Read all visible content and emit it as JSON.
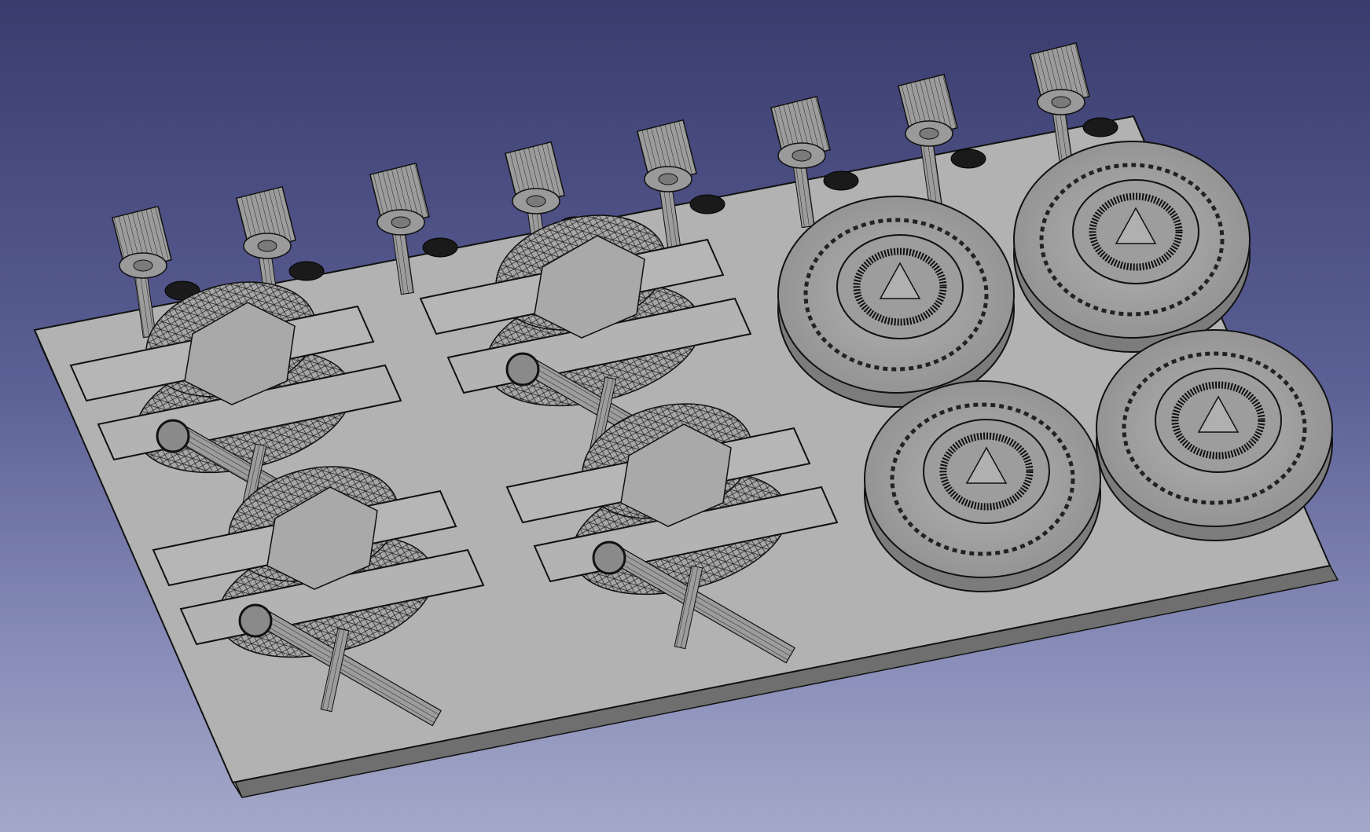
{
  "viewport": {
    "background_top": "#3a3c6e",
    "background_bottom": "#a4a8c8",
    "model_color": "#a8a8a8",
    "edge_color": "#111111"
  },
  "scene": {
    "part_rows": 2,
    "part_cols": 2,
    "disc_rows": 2,
    "disc_cols": 2,
    "knob_count": 8
  },
  "icons": {
    "knob": "cylinder-knob-icon",
    "disc": "gear-disc-icon",
    "arm": "linkage-arm-icon"
  }
}
